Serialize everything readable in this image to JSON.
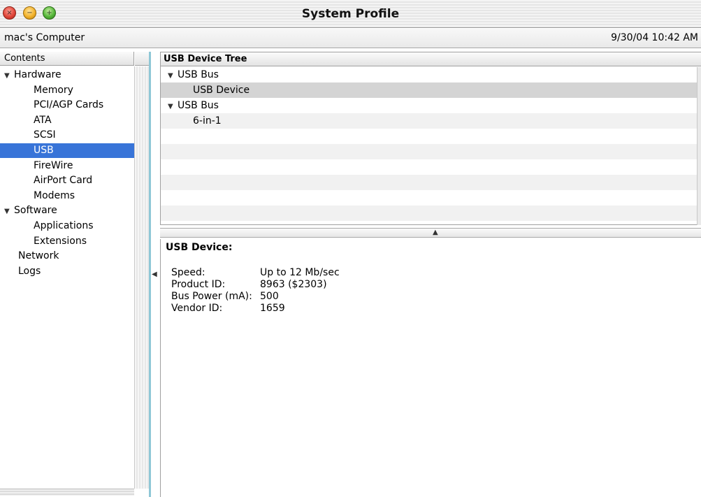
{
  "window": {
    "title": "System Profile",
    "close_glyph": "×",
    "minimize_glyph": "−",
    "zoom_glyph": "+"
  },
  "infobar": {
    "computer_name": "mac's Computer",
    "timestamp": "9/30/04 10:42 AM"
  },
  "sidebar": {
    "header": "Contents",
    "items": [
      {
        "label": "Hardware",
        "disclosure": "▼",
        "indent": 0,
        "selected": false
      },
      {
        "label": "Memory",
        "disclosure": "",
        "indent": 1,
        "selected": false
      },
      {
        "label": "PCI/AGP Cards",
        "disclosure": "",
        "indent": 1,
        "selected": false
      },
      {
        "label": "ATA",
        "disclosure": "",
        "indent": 1,
        "selected": false
      },
      {
        "label": "SCSI",
        "disclosure": "",
        "indent": 1,
        "selected": false
      },
      {
        "label": "USB",
        "disclosure": "",
        "indent": 1,
        "selected": true
      },
      {
        "label": "FireWire",
        "disclosure": "",
        "indent": 1,
        "selected": false
      },
      {
        "label": "AirPort Card",
        "disclosure": "",
        "indent": 1,
        "selected": false
      },
      {
        "label": "Modems",
        "disclosure": "",
        "indent": 1,
        "selected": false
      },
      {
        "label": "Software",
        "disclosure": "▼",
        "indent": 0,
        "selected": false
      },
      {
        "label": "Applications",
        "disclosure": "",
        "indent": 1,
        "selected": false
      },
      {
        "label": "Extensions",
        "disclosure": "",
        "indent": 1,
        "selected": false
      },
      {
        "label": "Network",
        "disclosure": "",
        "indent": 2,
        "selected": false
      },
      {
        "label": "Logs",
        "disclosure": "",
        "indent": 2,
        "selected": false
      }
    ]
  },
  "device_tree": {
    "header": "USB Device Tree",
    "rows": [
      {
        "label": "USB Bus",
        "disclosure": "▼",
        "level": 0,
        "selected": false
      },
      {
        "label": "USB Device",
        "disclosure": "",
        "level": 1,
        "selected": true
      },
      {
        "label": "USB Bus",
        "disclosure": "▼",
        "level": 0,
        "selected": false
      },
      {
        "label": "6-in-1",
        "disclosure": "",
        "level": 1,
        "selected": false
      },
      {
        "label": "",
        "disclosure": "",
        "level": 0,
        "selected": false
      },
      {
        "label": "",
        "disclosure": "",
        "level": 0,
        "selected": false
      },
      {
        "label": "",
        "disclosure": "",
        "level": 0,
        "selected": false
      },
      {
        "label": "",
        "disclosure": "",
        "level": 0,
        "selected": false
      },
      {
        "label": "",
        "disclosure": "",
        "level": 0,
        "selected": false
      },
      {
        "label": "",
        "disclosure": "",
        "level": 0,
        "selected": false
      }
    ]
  },
  "splitter": {
    "glyph": "▲"
  },
  "edge_marker": {
    "glyph": "◀"
  },
  "details": {
    "title": "USB Device:",
    "fields": [
      {
        "key": "Speed:",
        "value": "Up to 12 Mb/sec"
      },
      {
        "key": "Product ID:",
        "value": "8963 ($2303)"
      },
      {
        "key": "Bus Power (mA):",
        "value": "500"
      },
      {
        "key": "Vendor ID:",
        "value": "1659"
      }
    ]
  }
}
